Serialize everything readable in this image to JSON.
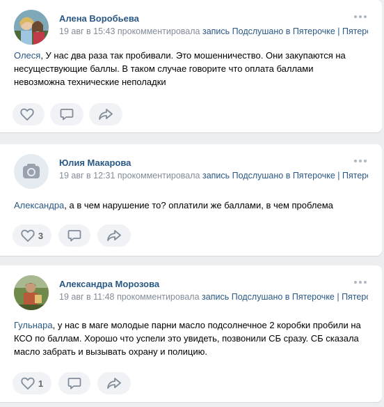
{
  "comments": [
    {
      "author": "Алена Воробьева",
      "date": "19 авг в 15:43",
      "verb": "прокомментировала",
      "link_label": "запись",
      "source": "Подслушано в Пятерочке | Пятерочка",
      "reply_to": "Олеся",
      "text": ", У нас два раза так пробивали. Это мошенничество. Они закупаются на несуществующие баллы. В таком случае говорите что оплата баллами невозможна технические неполадки",
      "likes": ""
    },
    {
      "author": "Юлия Макарова",
      "date": "19 авг в 12:31",
      "verb": "прокомментировала",
      "link_label": "запись",
      "source": "Подслушано в Пятерочке | Пятерочка",
      "reply_to": "Александра",
      "text": ", а в чем нарушение то? оплатили же баллами, в чем проблема",
      "likes": "3"
    },
    {
      "author": "Александра Морозова",
      "date": "19 авг в 11:48",
      "verb": "прокомментировала",
      "link_label": "запись",
      "source": "Подслушано в Пятерочке | Пятерочка",
      "reply_to": "Гульнара",
      "text": ", у нас в маге молодые парни масло подсолнечное 2 коробки пробили на КСО по баллам. Хорошо что успели это увидеть, позвонили СБ сразу. СБ сказала масло забрать и вызывать охрану и полицию.",
      "likes": "1"
    }
  ],
  "colors": {
    "link": "#2a5885",
    "meta": "#818c99",
    "background": "#edeef0",
    "action_bg": "#f0f2f5"
  },
  "icons": [
    "more-icon",
    "like-heart-icon",
    "comment-icon",
    "share-icon",
    "camera-placeholder-icon"
  ]
}
